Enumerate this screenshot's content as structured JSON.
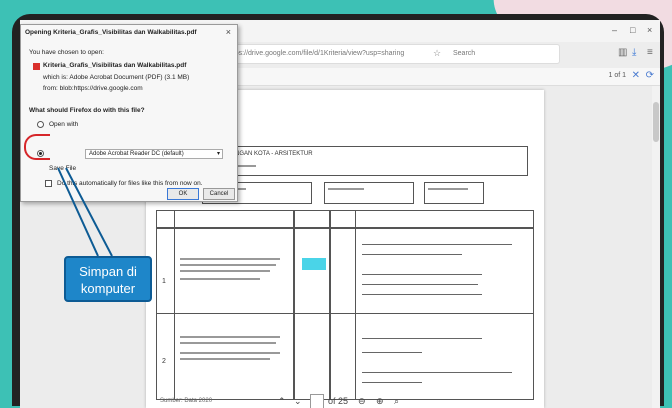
{
  "dialog": {
    "title": "Opening Kriteria_Grafis_Visibilitas dan Walkabilitas.pdf",
    "opened_label": "You have chosen to open:",
    "filename": "Kriteria_Grafis_Visibilitas dan Walkabilitas.pdf",
    "filetype": "which is: Adobe Acrobat Document (PDF) (3.1 MB)",
    "from": "from: blob:https://drive.google.com",
    "question": "What should Firefox do with this file?",
    "open_with_label": "Open with",
    "open_with_value": "Adobe Acrobat Reader DC (default)",
    "save_label": "Save File",
    "do_auto_label": "Do this automatically for files like this from now on.",
    "ok_label": "OK",
    "cancel_label": "Cancel"
  },
  "browser": {
    "url": "https://drive.google.com/file/d/1Kriteria/view?usp=sharing",
    "search_placeholder": "Search",
    "page_indicator": "1 of 1",
    "zoom_page": "1",
    "zoom_total": "of 25"
  },
  "document": {
    "header": "PERANCANGAN KOTA - ARSITEKTUR",
    "footer": "Sumber: Data 2020",
    "row_numbers": [
      "1",
      "2"
    ]
  },
  "annotation": {
    "callout_line1": "Simpan di",
    "callout_line2": "komputer"
  },
  "colors": {
    "background": "#3dc1b5",
    "callout": "#1e86c9",
    "marker": "#d6262a",
    "highlight": "#4ad4e8"
  }
}
